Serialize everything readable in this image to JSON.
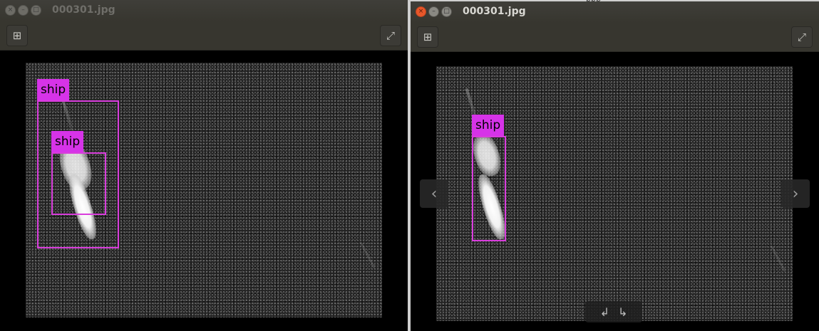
{
  "background_fragment": "ppp",
  "left_window": {
    "title": "000301.jpg",
    "detections": [
      {
        "label": "ship"
      },
      {
        "label": "ship"
      }
    ]
  },
  "right_window": {
    "title": "000301.jpg",
    "detections": [
      {
        "label": "ship"
      }
    ]
  },
  "icons": {
    "close": "close-icon",
    "minimize": "minimize-icon",
    "maximize": "maximize-icon",
    "add": "add-icon",
    "fullscreen": "fullscreen-icon",
    "prev": "chevron-left-icon",
    "next": "chevron-right-icon",
    "rotate_left": "rotate-left-icon",
    "rotate_right": "rotate-right-icon"
  },
  "colors": {
    "bbox": "#d93ddc",
    "label_bg": "#d633e8",
    "close_button": "#e8572a",
    "titlebar": "#3f3e39"
  }
}
